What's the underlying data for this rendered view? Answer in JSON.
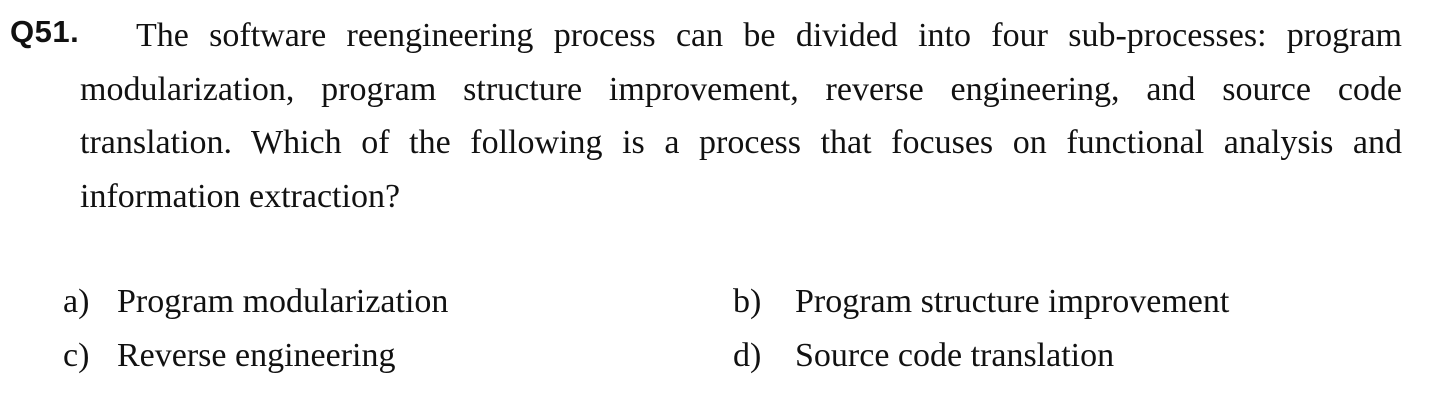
{
  "question": {
    "number": "Q51.",
    "text": "The software reengineering process can be divided into four sub-processes: program modularization, program structure improvement, reverse engineering,  and source code translation. Which of the following is a process that focuses on functional analysis and information extraction?"
  },
  "options": [
    {
      "letter": "a)",
      "text": "Program modularization"
    },
    {
      "letter": "b)",
      "text": "Program structure improvement"
    },
    {
      "letter": "c)",
      "text": "Reverse engineering"
    },
    {
      "letter": "d)",
      "text": "Source code translation"
    }
  ]
}
